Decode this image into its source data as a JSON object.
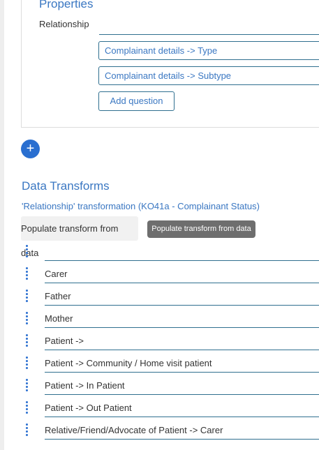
{
  "properties": {
    "title": "Properties",
    "relationship_label": "Relationship",
    "questions": [
      "Complainant details -> Type",
      "Complainant details -> Subtype"
    ],
    "add_question_label": "Add question"
  },
  "add_section_glyph": "+",
  "data_transforms": {
    "title": "Data Transforms",
    "transformation_label": "'Relationship' transformation (KO41a - Complainant Status)",
    "populate_button_label": "Populate transform from data",
    "tooltip_text": "Populate transform from data",
    "rows": [
      "",
      "Carer",
      "Father",
      "Mother",
      "Patient ->",
      "Patient -> Community / Home visit patient",
      "Patient -> In Patient",
      "Patient -> Out Patient",
      "Relative/Friend/Advocate of Patient -> Carer"
    ]
  },
  "colors": {
    "accent": "#3a77c2",
    "primary_button": "#2a6fd0",
    "underline": "#2f6f8f",
    "tooltip_bg": "#6e6e6e"
  }
}
